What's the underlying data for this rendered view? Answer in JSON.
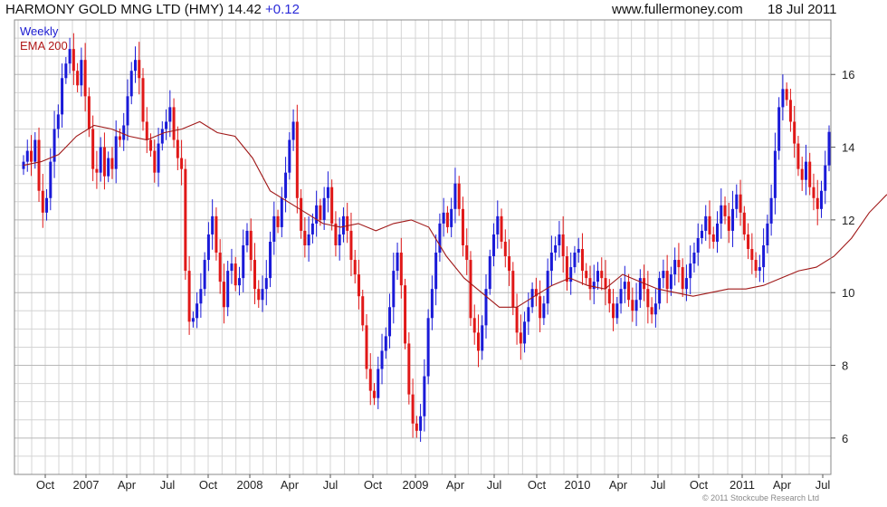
{
  "header": {
    "name": "HARMONY GOLD MNG LTD (HMY)",
    "price": "14.42",
    "change": "+0.12",
    "site": "www.fullermoney.com",
    "date": "18 Jul 2011"
  },
  "credit": "© 2011 Stockcube Research Ltd",
  "colors": {
    "up": "#1a1ad8",
    "down": "#e01818",
    "ema": "#a01818",
    "grid": "#d4d4d4",
    "frame": "#888888"
  },
  "chart_data": {
    "type": "line",
    "title": "HARMONY GOLD MNG LTD (HMY)",
    "xlabel": "",
    "ylabel": "",
    "grid": true,
    "legend_position": "top-left",
    "ylim": [
      5.0,
      17.5
    ],
    "y_ticks": [
      6,
      8,
      10,
      12,
      14,
      16
    ],
    "x_ticks": [
      "Oct",
      "2007",
      "Apr",
      "Jul",
      "Oct",
      "2008",
      "Apr",
      "Jul",
      "Oct",
      "2009",
      "Apr",
      "Jul",
      "Oct",
      "2010",
      "Apr",
      "Jul",
      "Oct",
      "2011",
      "Apr",
      "Jul"
    ],
    "series": [
      {
        "name": "Weekly",
        "style": "candlestick",
        "close": [
          13.6,
          13.9,
          13.6,
          14.2,
          12.8,
          12.2,
          12.6,
          13.6,
          14.5,
          14.9,
          15.9,
          16.3,
          16.7,
          16.1,
          15.7,
          16.4,
          15.4,
          14.5,
          13.4,
          13.3,
          14.0,
          13.2,
          13.7,
          13.4,
          14.3,
          14.2,
          14.6,
          15.4,
          16.1,
          16.4,
          15.9,
          14.7,
          14.2,
          13.9,
          13.3,
          14.1,
          14.5,
          14.7,
          15.1,
          14.2,
          13.7,
          13.4,
          10.6,
          9.2,
          9.3,
          9.7,
          10.1,
          10.9,
          11.6,
          12.1,
          11.1,
          10.3,
          9.6,
          10.6,
          10.8,
          10.2,
          10.4,
          11.3,
          11.7,
          10.9,
          10.1,
          9.8,
          10.1,
          10.4,
          11.4,
          12.1,
          11.8,
          12.6,
          13.3,
          14.2,
          14.7,
          12.6,
          11.7,
          11.3,
          11.6,
          11.9,
          12.4,
          12.0,
          12.6,
          12.9,
          11.9,
          11.3,
          11.6,
          12.1,
          11.7,
          10.9,
          10.5,
          9.9,
          9.1,
          7.9,
          7.3,
          7.1,
          7.9,
          8.4,
          8.8,
          9.6,
          10.6,
          11.1,
          10.2,
          8.6,
          7.2,
          6.4,
          6.2,
          6.6,
          7.7,
          9.3,
          10.1,
          11.1,
          11.9,
          12.2,
          11.8,
          12.3,
          13.0,
          12.3,
          11.3,
          10.9,
          9.3,
          8.9,
          8.4,
          9.1,
          10.1,
          11.0,
          11.6,
          12.1,
          11.4,
          11.0,
          10.6,
          9.6,
          8.9,
          8.6,
          9.2,
          9.6,
          10.1,
          9.9,
          9.3,
          9.7,
          10.6,
          11.1,
          11.3,
          11.6,
          11.0,
          10.3,
          10.7,
          11.1,
          11.2,
          10.6,
          10.4,
          10.1,
          10.3,
          10.6,
          10.4,
          10.1,
          9.7,
          9.3,
          9.7,
          10.1,
          10.3,
          9.8,
          9.5,
          9.8,
          10.4,
          10.1,
          9.6,
          9.4,
          9.7,
          10.4,
          10.6,
          10.1,
          10.5,
          10.9,
          10.7,
          10.1,
          10.4,
          10.8,
          11.1,
          11.5,
          11.7,
          12.1,
          11.6,
          11.4,
          11.9,
          12.4,
          12.1,
          11.7,
          12.3,
          12.7,
          12.2,
          11.6,
          11.2,
          10.9,
          10.6,
          10.7,
          11.3,
          11.9,
          12.6,
          13.9,
          15.1,
          15.6,
          15.3,
          14.7,
          14.1,
          13.4,
          13.1,
          13.6,
          12.9,
          12.6,
          12.3,
          12.8,
          13.5,
          14.42
        ]
      },
      {
        "name": "EMA 200",
        "style": "line",
        "values": [
          13.5,
          13.6,
          13.8,
          14.3,
          14.6,
          14.5,
          14.3,
          14.2,
          14.4,
          14.5,
          14.7,
          14.4,
          14.3,
          13.7,
          12.8,
          12.5,
          12.2,
          11.9,
          11.8,
          11.9,
          11.7,
          11.9,
          12.0,
          11.8,
          11.0,
          10.4,
          10.0,
          9.6,
          9.6,
          9.9,
          10.2,
          10.4,
          10.2,
          10.1,
          10.5,
          10.3,
          10.1,
          10.0,
          9.9,
          10.0,
          10.1,
          10.1,
          10.2,
          10.4,
          10.6,
          10.7,
          11.0,
          11.5,
          12.2,
          12.7
        ],
        "x_span": [
          0,
          224
        ]
      }
    ]
  }
}
